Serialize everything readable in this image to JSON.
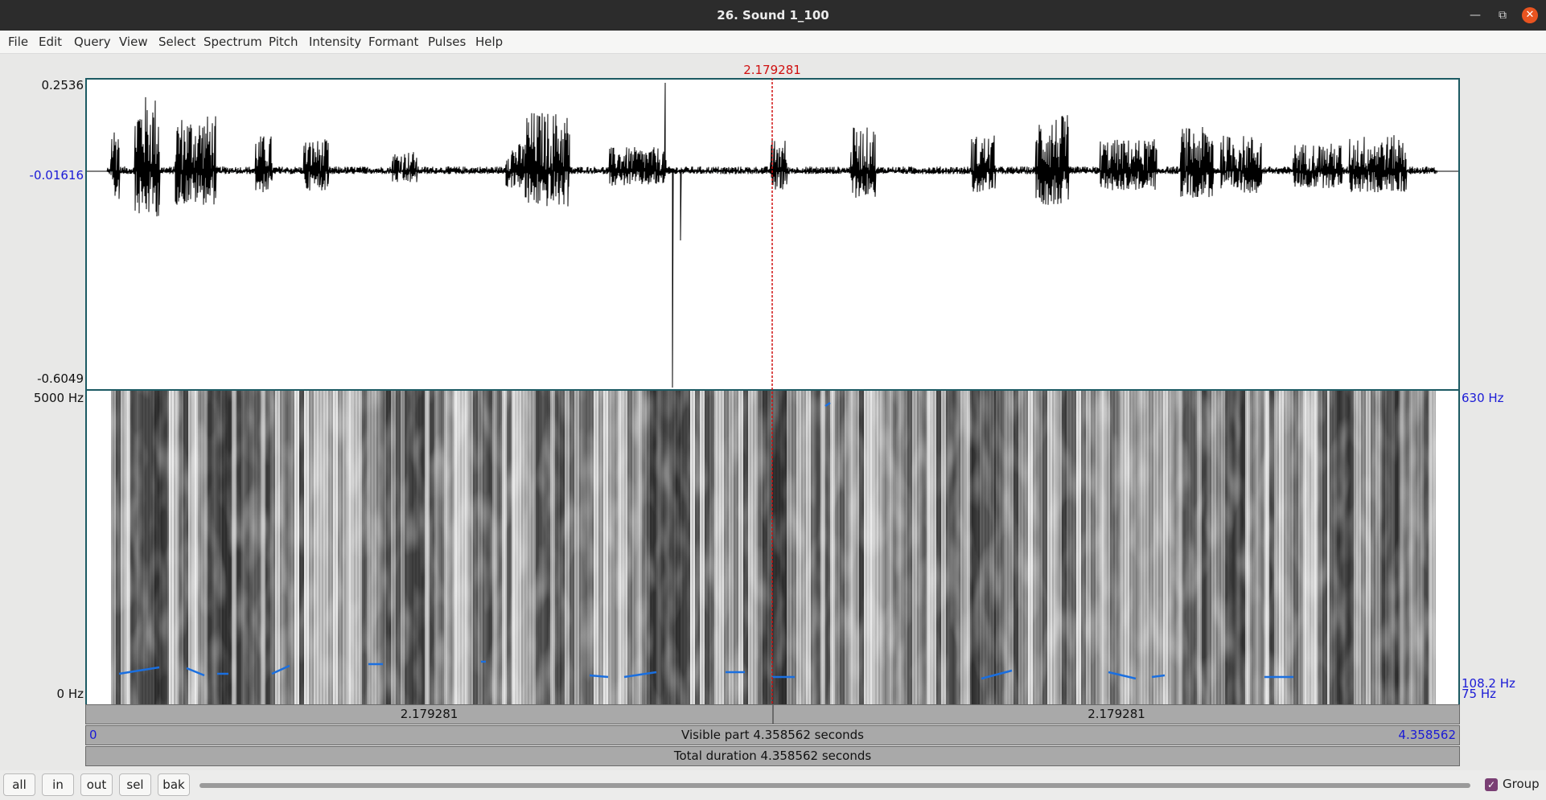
{
  "window": {
    "title": "26. Sound 1_100",
    "minimize_icon": "minimize-icon",
    "maximize_icon": "maximize-icon",
    "close_icon": "close-icon"
  },
  "menu": [
    "File",
    "Edit",
    "Query",
    "View",
    "Select",
    "Spectrum",
    "Pitch",
    "Intensity",
    "Formant",
    "Pulses",
    "Help"
  ],
  "cursor": {
    "time_label": "2.179281",
    "time": 2.179281
  },
  "waveform": {
    "y_max_label": "0.2536",
    "y_mid_label": "-0.01616",
    "y_min_label": "-0.6049",
    "y_max": 0.2536,
    "y_mid": -0.01616,
    "y_min": -0.6049
  },
  "spectrogram": {
    "top_label": "5000 Hz",
    "bottom_label": "0 Hz",
    "pitch_top_label": "630 Hz",
    "pitch_cursor_label": "108.2 Hz",
    "pitch_bottom_label": "75 Hz"
  },
  "bars": {
    "left_segment": "2.179281",
    "right_segment": "2.179281",
    "visible_start": "0",
    "visible_text": "Visible part 4.358562 seconds",
    "visible_end": "4.358562",
    "total_text": "Total duration 4.358562 seconds"
  },
  "buttons": {
    "all": "all",
    "in": "in",
    "out": "out",
    "sel": "sel",
    "bak": "bak"
  },
  "group": {
    "label": "Group",
    "checked": true
  },
  "colors": {
    "cursor": "#d01010",
    "pitch": "#1a6fe0",
    "frame": "#1c5a63",
    "axis_blue": "#1a1ad6"
  }
}
